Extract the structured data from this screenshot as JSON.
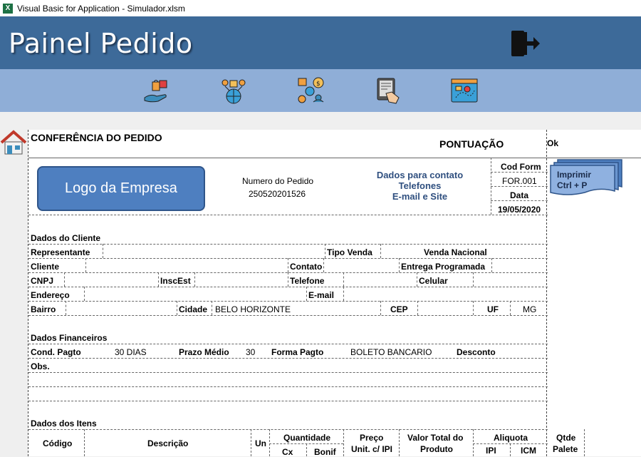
{
  "window": {
    "title": "Visual Basic for Application - Simulador.xlsm"
  },
  "header": {
    "title": "Painel Pedido"
  },
  "toolbar": {
    "icons": [
      "hand-cart-icon",
      "globe-network-icon",
      "logistics-icon",
      "tablet-touch-icon",
      "map-screen-icon"
    ]
  },
  "form": {
    "title": "CONFERÊNCIA DO PEDIDO",
    "pontuacao_label": "PONTUAÇÃO",
    "pontuacao_value": "Ok",
    "logo": "Logo da Empresa",
    "numero_label": "Numero do Pedido",
    "numero_value": "250520201526",
    "contact": {
      "line1": "Dados para contato",
      "line2": "Telefones",
      "line3": "E-mail e Site"
    },
    "cod_form_label": "Cod Form",
    "cod_form_value": "FOR.001",
    "data_label": "Data",
    "data_value": "19/05/2020",
    "print_label_1": "Imprimir",
    "print_label_2": "Ctrl + P"
  },
  "cliente": {
    "section": "Dados do Cliente",
    "representante": "Representante",
    "tipo_venda": "Tipo Venda",
    "tipo_venda_value": "Venda Nacional",
    "cliente": "Cliente",
    "contato": "Contato",
    "entrega": "Entrega Programada",
    "cnpj": "CNPJ",
    "inscest": "InscEst",
    "telefone": "Telefone",
    "celular": "Celular",
    "endereco": "Endereço",
    "email": "E-mail",
    "bairro": "Bairro",
    "cidade": "Cidade",
    "cidade_value": "BELO HORIZONTE",
    "cep": "CEP",
    "uf": "UF",
    "uf_value": "MG"
  },
  "financeiro": {
    "section": "Dados Financeiros",
    "cond_pagto": "Cond. Pagto",
    "cond_pagto_value": "30 DIAS",
    "prazo": "Prazo Médio",
    "prazo_value": "30",
    "forma": "Forma Pagto",
    "forma_value": "BOLETO BANCARIO",
    "desconto": "Desconto",
    "obs": "Obs."
  },
  "itens": {
    "section": "Dados dos Itens",
    "codigo": "Código",
    "descricao": "Descrição",
    "un": "Un",
    "quantidade": "Quantidade",
    "cx": "Cx",
    "bonif": "Bonif",
    "preco_1": "Preço",
    "preco_2": "Unit. c/ IPI",
    "valor_1": "Valor Total do",
    "valor_2": "Produto",
    "aliquota": "Aliquota",
    "ipi": "IPI",
    "icm": "ICM",
    "qtde_1": "Qtde",
    "qtde_2": "Palete"
  }
}
